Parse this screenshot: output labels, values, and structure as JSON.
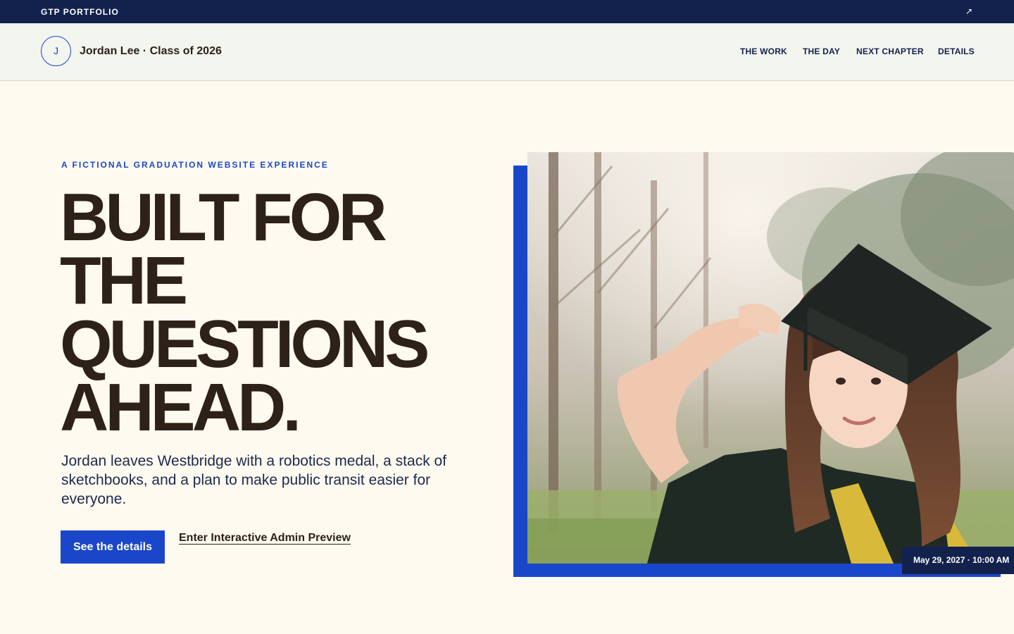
{
  "topbar": {
    "brand": "GTP PORTFOLIO",
    "expand_icon": "external-arrow-icon"
  },
  "header": {
    "avatar_initial": "J",
    "site_name": "Jordan Lee · Class of 2026",
    "nav": [
      "THE WORK",
      "THE DAY",
      "NEXT CHAPTER",
      "DETAILS"
    ]
  },
  "hero": {
    "eyebrow": "A FICTIONAL GRADUATION WEBSITE EXPERIENCE",
    "headline_lines": [
      "BUILT FOR",
      "THE",
      "QUESTIONS",
      "AHEAD."
    ],
    "lede": "Jordan leaves Westbridge with a robotics medal, a stack of sketchbooks, and a plan to make public transit easier for everyone.",
    "primary_button": "See the details",
    "secondary_link": "Enter Interactive Admin Preview",
    "date_badge": "May 29, 2027 · 10:00 AM"
  },
  "colors": {
    "navy": "#13224d",
    "accent_blue": "#1a47c9",
    "background": "#fffaf0",
    "text_dark": "#2d2118"
  }
}
